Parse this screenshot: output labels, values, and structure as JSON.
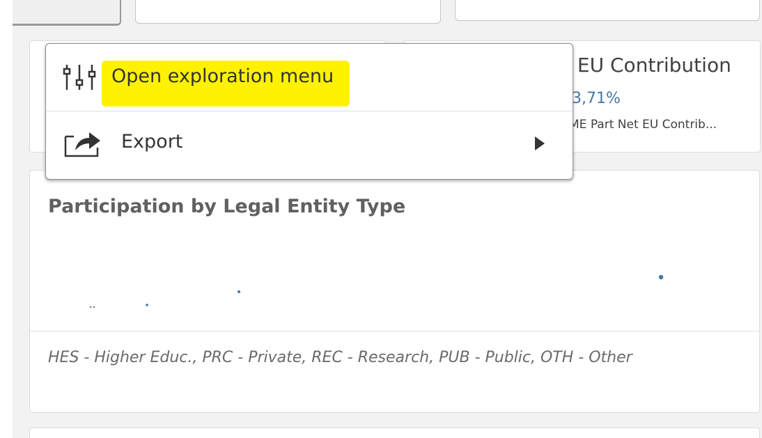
{
  "kpi": {
    "title": "t EU Contribution",
    "value": "3,71%",
    "subtitle": "ME Part Net EU Contrib..."
  },
  "chart": {
    "title": "Participation by Legal Entity Type",
    "footnote": "HES - Higher Educ., PRC - Private, REC - Research, PUB - Public, OTH - Other"
  },
  "context_menu": {
    "items": [
      {
        "label": "Open exploration menu",
        "icon": "sliders-icon",
        "highlighted": true
      },
      {
        "label": "Export",
        "icon": "export-share-icon",
        "has_submenu": true
      }
    ]
  },
  "colors": {
    "accent": "#4477aa",
    "highlight": "#fff200",
    "menu_text": "#333333",
    "title_text": "#606060"
  }
}
